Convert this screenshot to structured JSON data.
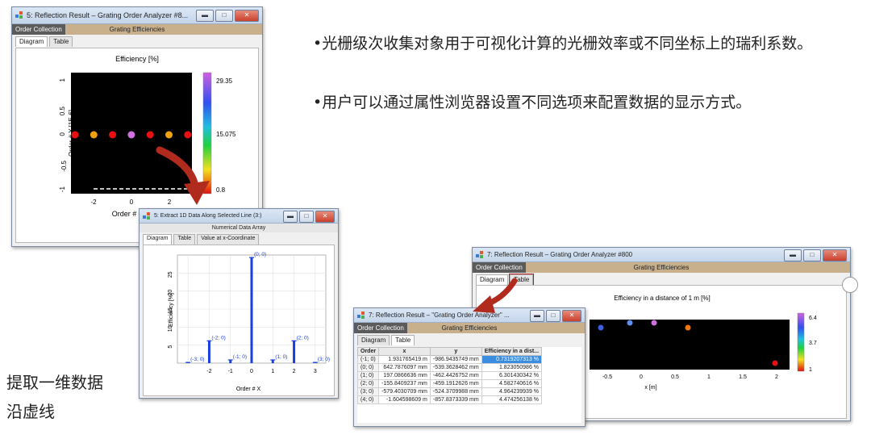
{
  "bullets": [
    "•光栅级次收集对象用于可视化计算的光栅效率或不同坐标上的瑞利系数。",
    "•用户可以通过属性浏览器设置不同选项来配置数据的显示方式。"
  ],
  "caption": [
    "提取一维数据",
    "沿虚线"
  ],
  "win1": {
    "title": "5: Reflection Result – Grating Order Analyzer #8...",
    "menu_left": "Order Collection",
    "menu_center": "Grating Efficiencies",
    "tabs": [
      "Diagram",
      "Table"
    ],
    "plot_title": "Efficiency  [%]",
    "ylabel": "Order # Y [1E-6]",
    "xlabel": "Order #",
    "yticks": [
      "1",
      "0.5",
      "0",
      "-0.5",
      "-1"
    ],
    "xticks": [
      "-2",
      "0",
      "2"
    ],
    "colorbar_labels": [
      "29.35",
      "15.075",
      "0.8"
    ],
    "colors": {
      "points": [
        "#e81010",
        "#f2a010",
        "#e81010",
        "#d070e0",
        "#e81010",
        "#f2a010",
        "#e81010"
      ]
    }
  },
  "win2": {
    "title": "5: Extract 1D Data Along Selected Line (3:)",
    "menu_center": "Numerical Data Array",
    "tabs": [
      "Diagram",
      "Table",
      "Value at x-Coordinate"
    ],
    "ylabel": "Efficiency [%]",
    "xlabel": "Order # X",
    "yticks": [
      "25",
      "20",
      "15",
      "10",
      "5"
    ],
    "xticks": [
      "-2",
      "-1",
      "0",
      "1",
      "2",
      "3"
    ],
    "point_labels": [
      "(-3; 0)",
      "(-2; 0)",
      "(-1; 0)",
      "(0; 0)",
      "(1; 0)",
      "(2; 0)",
      "(3; 0)"
    ]
  },
  "win3": {
    "title": "7: Reflection Result – Grating Order Analyzer #800",
    "menu_left": "Order Collection",
    "menu_center": "Grating Efficiencies",
    "tabs": [
      "Diagram",
      "Table"
    ],
    "plot_title": "Efficiency in a distance of 1 m  [%]",
    "xticks": [
      "-0.5",
      "0",
      "0.5",
      "1",
      "1.5",
      "2"
    ],
    "xlabel": "x [m]",
    "colorbar_labels": [
      "6.4",
      "3.7",
      "1"
    ],
    "colors": {
      "points": [
        "#3b5fe0",
        "#5f8ff0",
        "#d070e0",
        "#f07a10",
        "#e81010"
      ]
    }
  },
  "win4": {
    "title": "7: Reflection Result – \"Grating Order Analyzer\" ...",
    "menu_left": "Order Collection",
    "menu_center": "Grating Efficiencies",
    "tabs": [
      "Diagram",
      "Table"
    ],
    "columns": [
      "Order",
      "x",
      "y",
      "Efficiency in a dist..."
    ],
    "rows": [
      [
        "(-1; 0)",
        "1.931765419 m",
        "-986.9435749 mm",
        "0.7319207313 %"
      ],
      [
        "(0; 0)",
        "642.7876097 mm",
        "-539.3628462 mm",
        "1.823050986 %"
      ],
      [
        "(1; 0)",
        "197.0866636 mm",
        "-462.4426752 mm",
        "6.301430342 %"
      ],
      [
        "(2; 0)",
        "-155.8409237 mm",
        "-459.1912626 mm",
        "4.582740616 %"
      ],
      [
        "(3; 0)",
        "-579.4030709 mm",
        "-524.3709988 mm",
        "4.964239939 %"
      ],
      [
        "(4; 0)",
        "-1.604598609 m",
        "-857.8373339 mm",
        "4.474256138 %"
      ]
    ]
  },
  "chart_data": {
    "type": "bar",
    "categories": [
      "-3",
      "-2",
      "-1",
      "0",
      "1",
      "2",
      "3"
    ],
    "values": [
      0.2,
      6.2,
      0.9,
      29.3,
      0.9,
      6.2,
      0.2
    ],
    "xlabel": "Order # X",
    "ylabel": "Efficiency [%]",
    "ylim": [
      0,
      30
    ]
  }
}
